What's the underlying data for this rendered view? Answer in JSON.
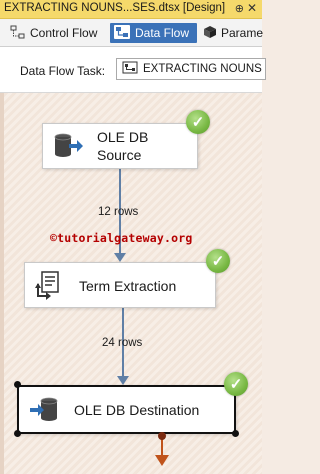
{
  "window": {
    "title": "EXTRACTING NOUNS...SES.dtsx [Design]",
    "pin_glyph": "⊕",
    "close_glyph": "✕"
  },
  "tabs": [
    {
      "label": "Control Flow",
      "icon": "control-flow-icon",
      "active": false
    },
    {
      "label": "Data Flow",
      "icon": "data-flow-icon",
      "active": true
    },
    {
      "label": "Parame",
      "icon": "parameters-icon",
      "active": false
    }
  ],
  "task_bar": {
    "label": "Data Flow Task:",
    "selected_value": "EXTRACTING NOUNS"
  },
  "components": [
    {
      "name": "OLE DB Source",
      "line1": "OLE DB",
      "line2": "Source",
      "icon": "ole-db-source-icon",
      "status": "success"
    },
    {
      "name": "Term Extraction",
      "icon": "term-extraction-icon",
      "status": "success"
    },
    {
      "name": "OLE DB Destination",
      "icon": "ole-db-destination-icon",
      "status": "success"
    }
  ],
  "paths": [
    {
      "label": "12 rows"
    },
    {
      "label": "24 rows"
    }
  ],
  "watermark": "©tutorialgateway.org",
  "colors": {
    "active_tab": "#3b72b8",
    "title_bar": "#f5d96b",
    "success": "#78b843",
    "path_line": "#5f7fa6",
    "error_path": "#c0531b",
    "watermark": "#b40000"
  }
}
